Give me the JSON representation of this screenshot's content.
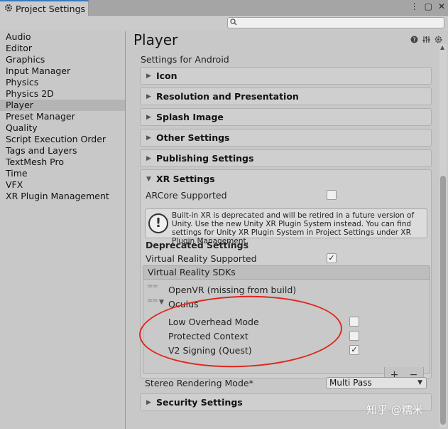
{
  "window": {
    "tab_title": "Project Settings",
    "controls": [
      "⋮",
      "▢",
      "✕"
    ]
  },
  "search": {
    "placeholder": ""
  },
  "nav": {
    "items": [
      {
        "label": "Audio",
        "active": false
      },
      {
        "label": "Editor",
        "active": false
      },
      {
        "label": "Graphics",
        "active": false
      },
      {
        "label": "Input Manager",
        "active": false
      },
      {
        "label": "Physics",
        "active": false
      },
      {
        "label": "Physics 2D",
        "active": false
      },
      {
        "label": "Player",
        "active": true
      },
      {
        "label": "Preset Manager",
        "active": false
      },
      {
        "label": "Quality",
        "active": false
      },
      {
        "label": "Script Execution Order",
        "active": false
      },
      {
        "label": "Tags and Layers",
        "active": false
      },
      {
        "label": "TextMesh Pro",
        "active": false
      },
      {
        "label": "Time",
        "active": false
      },
      {
        "label": "VFX",
        "active": false
      },
      {
        "label": "XR Plugin Management",
        "active": false
      }
    ]
  },
  "main": {
    "title": "Player",
    "settings_for": "Settings for Android",
    "sections": [
      {
        "label": "Icon"
      },
      {
        "label": "Resolution and Presentation"
      },
      {
        "label": "Splash Image"
      },
      {
        "label": "Other Settings"
      },
      {
        "label": "Publishing Settings"
      }
    ],
    "xr": {
      "label": "XR Settings",
      "arcore_label": "ARCore Supported",
      "arcore_checked": false,
      "help_text": "Built-in XR is deprecated and will be retired in a future version of Unity. Use the new Unity XR Plugin System instead. You can find settings for Unity XR Plugin System in Project Settings under XR Plugin Management.",
      "deprecated_label": "Deprecated Settings",
      "vr_supported_label": "Virtual Reality Supported",
      "vr_supported_checked": true,
      "sdks_header": "Virtual Reality SDKs",
      "sdk_openvr": "OpenVR (missing from build)",
      "sdk_oculus": "Oculus",
      "oculus_options": [
        {
          "label": "Low Overhead Mode",
          "checked": false
        },
        {
          "label": "Protected Context",
          "checked": false
        },
        {
          "label": "V2 Signing (Quest)",
          "checked": true
        }
      ],
      "add_label": "+",
      "remove_label": "−",
      "stereo_label": "Stereo Rendering Mode*",
      "stereo_value": "Multi Pass"
    },
    "security_label": "Security Settings"
  },
  "watermark": "知乎 @糯米",
  "colors": {
    "annotation": "#e0271e",
    "tab_accent": "#3a79bb"
  }
}
